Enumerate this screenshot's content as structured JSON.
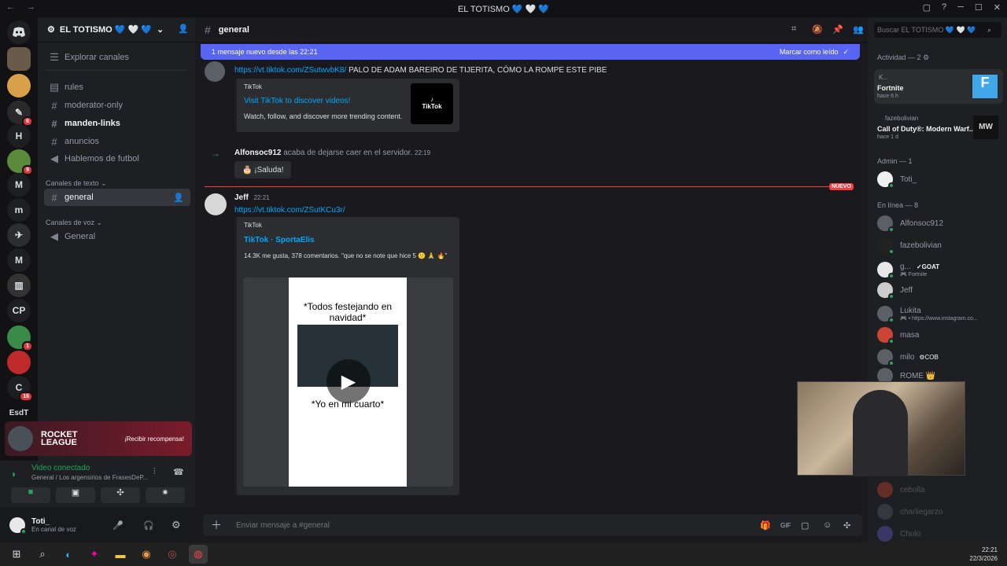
{
  "window": {
    "title": "EL TOTISMO 💙 🤍 💙"
  },
  "servers": {
    "items": [
      {
        "label": ""
      },
      {
        "label": ""
      },
      {
        "label": "",
        "badge": "6"
      },
      {
        "label": "H"
      },
      {
        "label": "",
        "badge": "9"
      },
      {
        "label": "M"
      },
      {
        "label": "m"
      },
      {
        "label": ""
      },
      {
        "label": "M"
      },
      {
        "label": ""
      },
      {
        "label": "CP"
      },
      {
        "label": "",
        "badge": "1"
      },
      {
        "label": ""
      },
      {
        "label": "C",
        "badge": "16"
      },
      {
        "label": "EsdT"
      }
    ]
  },
  "sidebar": {
    "server_name": "EL TOTISMO 💙 🤍 💙",
    "explore": "Explorar canales",
    "channels": [
      {
        "name": "rules"
      },
      {
        "name": "moderator-only"
      },
      {
        "name": "manden-links"
      },
      {
        "name": "anuncios"
      },
      {
        "name": "Hablemos de futbol"
      }
    ],
    "text_category": "Canales de texto",
    "text_channels": [
      {
        "name": "general"
      }
    ],
    "voice_category": "Canales de voz",
    "voice_channels": [
      {
        "name": "General"
      }
    ]
  },
  "promo": {
    "brand": "ROCKET LEAGUE",
    "cta": "¡Recibir recompensa!"
  },
  "voice": {
    "status": "Video conectado",
    "location": "General / Los argensirios de FrasesDeP..."
  },
  "user": {
    "name": "Toti_",
    "status": "En canal de voz"
  },
  "header": {
    "channel": "general"
  },
  "banner": {
    "text": "1 mensaje nuevo desde las 22:21",
    "action": "Marcar como leído"
  },
  "messages": {
    "first": {
      "link": "https://vt.tiktok.com/ZSutwvbK8/",
      "text": "PALO DE ADAM BAREIRO DE TIJERITA, CÓMO LA ROMPE ESTE PIBE",
      "embed": {
        "provider": "TikTok",
        "title": "Visit TikTok to discover videos!",
        "desc": "Watch, follow, and discover more trending content.",
        "thumb": "TikTok"
      }
    },
    "join": {
      "user": "Alfonsoc912",
      "text": "acaba de dejarse caer en el servidor.",
      "time": "22:19",
      "button": "¡Saluda!"
    },
    "divider": "NUEVO",
    "jeff": {
      "user": "Jeff",
      "time": "22:21",
      "link": "https://vt.tiktok.com/ZSutKCu3r/",
      "embed": {
        "provider": "TikTok",
        "title": "TikTok · SportaElis",
        "desc": "14.3K me gusta, 378 comentarios. \"que no se note que hice 5 🙂 🙏 🔥\"",
        "video_top": "*Todos festejando en navidad*",
        "video_bottom": "*Yo en mi cuarto*"
      }
    }
  },
  "composer": {
    "placeholder": "Enviar mensaje a #general"
  },
  "search": {
    "placeholder": "Buscar EL TOTISMO 💙 🤍 💙"
  },
  "members": {
    "activity_title": "Actividad — 2",
    "activities": [
      {
        "user": "K...",
        "game": "Fortnite",
        "when": "hace 6 h"
      },
      {
        "user": "fazebolivian",
        "game": "Call of Duty®: Modern Warf...",
        "when": "hace 1 d"
      }
    ],
    "admin_title": "Admin — 1",
    "admins": [
      {
        "name": "Toti_"
      }
    ],
    "online_title": "En línea — 8",
    "online": [
      {
        "name": "Alfonsoc912"
      },
      {
        "name": "fazebolivian"
      },
      {
        "name": "g...",
        "tag": "GOAT",
        "sub": "Fortnite"
      },
      {
        "name": "Jeff"
      },
      {
        "name": "Lukita",
        "sub": "• https://www.instagram.co..."
      },
      {
        "name": "masa"
      },
      {
        "name": "milo",
        "tag": "COB"
      },
      {
        "name": "ROME 👑"
      }
    ],
    "offline": [
      {
        "name": "cebolla"
      },
      {
        "name": "charliegarzo"
      },
      {
        "name": "Chulo"
      }
    ]
  },
  "taskbar": {
    "time": "22:21",
    "date": "22/3/2026"
  }
}
